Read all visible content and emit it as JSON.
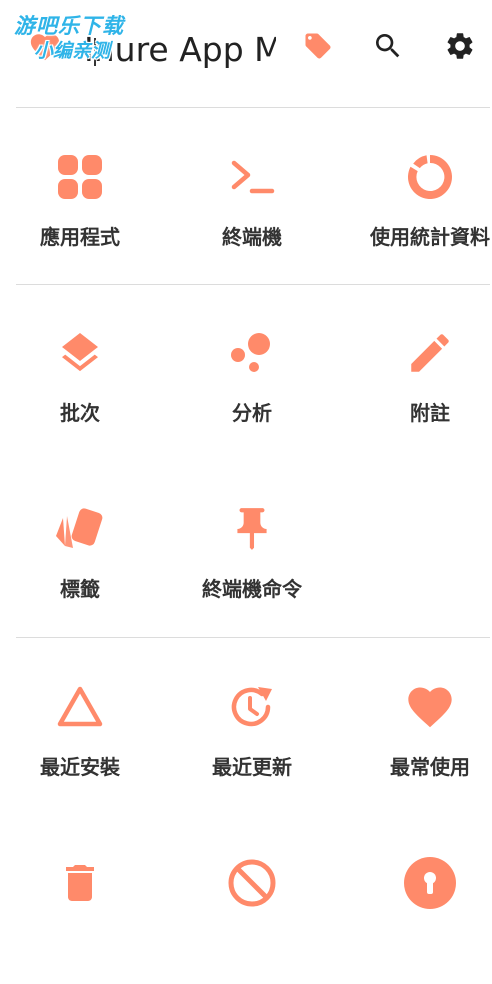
{
  "accent_color": "#FF8A6A",
  "header": {
    "title": "Inure App Manager",
    "icons": [
      "app-logo-heart",
      "tag-icon",
      "search-icon",
      "settings-gear-icon"
    ]
  },
  "watermark": {
    "line1": "游吧乐下载",
    "line2": "小编亲测"
  },
  "sections": [
    {
      "tiles": [
        {
          "label": "應用程式",
          "icon": "apps-grid-icon"
        },
        {
          "label": "終端機",
          "icon": "terminal-icon"
        },
        {
          "label": "使用統計資料",
          "icon": "usage-ring-icon"
        }
      ]
    },
    {
      "tiles": [
        {
          "label": "批次",
          "icon": "layers-icon"
        },
        {
          "label": "分析",
          "icon": "bubbles-icon"
        },
        {
          "label": "附註",
          "icon": "pencil-icon"
        },
        {
          "label": "標籤",
          "icon": "tag-cards-icon"
        },
        {
          "label": "終端機命令",
          "icon": "pin-icon"
        }
      ]
    },
    {
      "tiles": [
        {
          "label": "最近安裝",
          "icon": "triangle-icon"
        },
        {
          "label": "最近更新",
          "icon": "update-clock-icon"
        },
        {
          "label": "最常使用",
          "icon": "heart-icon"
        },
        {
          "icon": "trash-icon"
        },
        {
          "icon": "block-icon"
        },
        {
          "icon": "keyhole-icon"
        }
      ]
    }
  ]
}
